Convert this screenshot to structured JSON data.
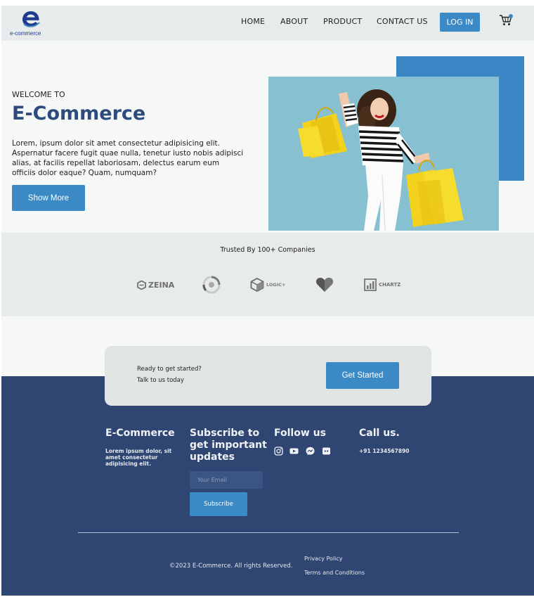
{
  "header": {
    "logo_text": "e-commerce",
    "nav": [
      "HOME",
      "ABOUT",
      "PRODUCT",
      "CONTACT US"
    ],
    "login_label": "LOG IN",
    "cart_icon": "shopping-cart-icon"
  },
  "hero": {
    "welcome": "WELCOME TO",
    "title": "E-Commerce",
    "description": "Lorem, ipsum dolor sit amet consectetur adipisicing elit. Aspernatur facere fugit quae nulla, tenetur iusto nobis adipisci alias, at facilis repellat laboriosam, delectus earum eum officiis dolor eaque? Quam, numquam?",
    "button": "Show More"
  },
  "trusted": {
    "title": "Trusted By 100+ Companies",
    "brands": [
      "ZEINA",
      "LOGIC+",
      "CHARTZ"
    ]
  },
  "cta": {
    "line1": "Ready to get started?",
    "line2": "Talk to us today",
    "button": "Get Started"
  },
  "footer": {
    "brand": {
      "title": "E-Commerce",
      "text": "Lorem ipsum dolor, sit amet consectetur adipisicing elit."
    },
    "subscribe": {
      "title": "Subscribe to get important updates",
      "placeholder": "Your Email",
      "button": "Subscribe"
    },
    "follow": {
      "title": "Follow us",
      "icons": [
        "instagram-icon",
        "youtube-icon",
        "messenger-icon",
        "discord-icon"
      ]
    },
    "call": {
      "title": "Call us.",
      "phone": "+91 1234567890"
    },
    "copyright": "©2023 E-Commerce. All rights Reserved.",
    "links": [
      "Privacy Policy",
      "Terms and Conditions"
    ]
  },
  "colors": {
    "accent": "#3b8ac6",
    "heading": "#2e4b7d",
    "footer_bg": "#2f4672",
    "header_bg": "#e8ebeb"
  }
}
